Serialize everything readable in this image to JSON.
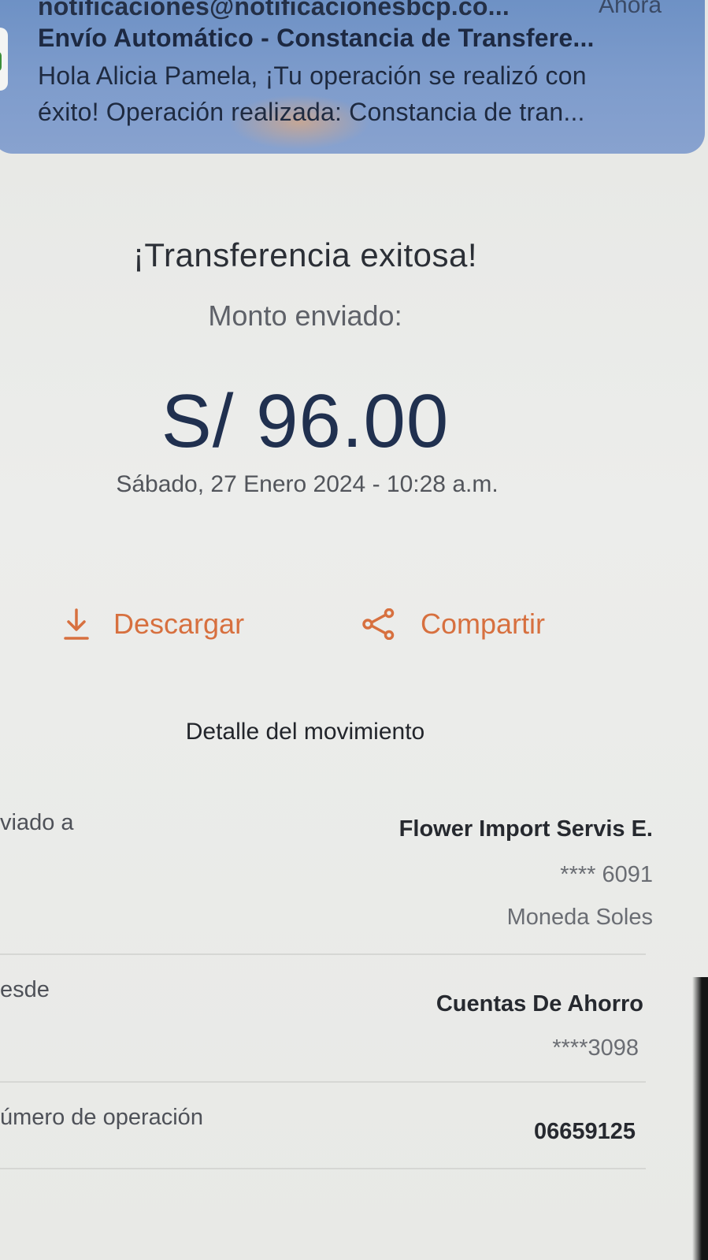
{
  "notification": {
    "sender": "notificaciones@notificacionesbcp.co...",
    "time": "Ahora",
    "subject": "Envío Automático - Constancia de Transfere...",
    "body_line1": "Hola Alicia Pamela, ¡Tu operación se realizó con",
    "body_line2": "éxito! Operación realizada: Constancia de tran..."
  },
  "receipt": {
    "title": "¡Transferencia exitosa!",
    "amount_label": "Monto enviado:",
    "amount": "S/ 96.00",
    "datetime": "Sábado, 27 Enero 2024 - 10:28 a.m."
  },
  "actions": {
    "download_label": "Descargar",
    "share_label": "Compartir"
  },
  "details": {
    "section_title": "Detalle del movimiento",
    "sent_to": {
      "label": "viado a",
      "name": "Flower Import Servis E.",
      "account": "**** 6091",
      "currency": "Moneda Soles"
    },
    "from": {
      "label": "esde",
      "account_type": "Cuentas De Ahorro",
      "account": "****3098"
    },
    "operation": {
      "label": "úmero de operación",
      "number": "06659125"
    }
  },
  "colors": {
    "accent": "#d7703f",
    "amount": "#20304f",
    "notification_bg": "#7e9ccc"
  },
  "icons": {
    "download": "download-icon",
    "share": "share-icon"
  }
}
